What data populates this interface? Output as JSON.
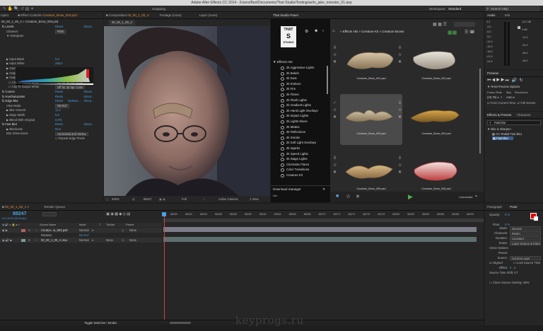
{
  "window_title": "Adobe After Effects CC 2014 - /Users/Bart/Documents/That Studio/Testing/ae/ts_jake_monster_01.aep",
  "toolbar": {
    "snapping": "Snapping",
    "workspace_label": "Workspace:",
    "workspace_value": "Standard",
    "search_placeholder": "Search Help"
  },
  "tabs": {
    "project": "roject",
    "effect_controls": "Effect Controls",
    "effect_controls_file": "Creature_Brow_003.psd",
    "composition": "Composition",
    "composition_name": "00_00_1_00_A",
    "footage": "Footage (none)",
    "layer": "Layer (none)",
    "tsp": "That Studio Panel",
    "audio": "Audio",
    "info": "Info",
    "preview": "Preview",
    "effects_presets": "Effects & Presets",
    "character": "Character",
    "paragraph": "Paragraph",
    "paint": "Paint"
  },
  "effect_controls": {
    "header": "00_00_1_00_A » Creature_Brow_003.psd",
    "rows": [
      {
        "label": "fx  Levels",
        "v1": "Reset",
        "v2": "About...",
        "indent": 0
      },
      {
        "label": "Channel:",
        "select": "RGB",
        "indent": 2
      },
      {
        "label": "▼ Histogram",
        "indent": 2
      },
      {
        "label": "▶ Input Black",
        "v1": "0,0",
        "indent": 2
      },
      {
        "label": "▶ Input White",
        "v1": "255,0",
        "indent": 2
      },
      {
        "label": "▶ Gamma",
        "v1": "1,00",
        "indent": 2
      },
      {
        "label": "▶ Output Black",
        "v1": "0,0",
        "indent": 2
      },
      {
        "label": "▶ Output White",
        "v1": "128,0",
        "indent": 2
      },
      {
        "label": "☐ Clip To Output Black",
        "select": "Off for 32 bpc Color",
        "indent": 3
      },
      {
        "label": "☐ Clip To Output White",
        "select": "Off for 32 bpc Color",
        "indent": 3
      },
      {
        "label": "fx  Curves",
        "v1": "Reset",
        "v2": "About...",
        "indent": 0
      },
      {
        "label": "fx  Hue/Saturation",
        "v1": "Reset",
        "v2": "About...",
        "indent": 0
      },
      {
        "label": "fx  Edge Blur",
        "v1": "Reset",
        "v2": "Options...",
        "v3": "About...",
        "indent": 0
      },
      {
        "label": "View Mode",
        "select": "Normal",
        "indent": 2
      },
      {
        "label": "▶ Blur Amount",
        "v1": "11,1",
        "indent": 2
      },
      {
        "label": "▶ Edge Width",
        "v1": "8,6",
        "indent": 2
      },
      {
        "label": "▶ Blend With Original",
        "v1": "0,0%",
        "indent": 2
      },
      {
        "label": "fx  Fast Blur",
        "v1": "Reset",
        "v2": "About...",
        "indent": 0
      },
      {
        "label": "▶ Blurriness",
        "v1": "50,0",
        "indent": 2
      },
      {
        "label": "Blur Dimensions",
        "select": "Horizontal and Vertic▾",
        "indent": 2
      },
      {
        "label": "",
        "check": "☐ Repeat Edge Pixels",
        "indent": 2
      }
    ]
  },
  "composition": {
    "zoom": "200%",
    "timecode": "88247",
    "resolution": "Full",
    "camera": "Active Camera",
    "views": "1 View"
  },
  "tsp": {
    "logo_lines": [
      "THAT",
      "S",
      "STUDIO"
    ],
    "category": "Effects HD",
    "breadcrumb": "» Effects HD » Creature Kit » Creature Brows",
    "items": [
      "2k Aggressive Lights",
      "2k Bokeh",
      "2k Dust",
      "2k Embers",
      "2k Fire",
      "2k Flares",
      "2k Flash Lights",
      "2k Gradient Lights",
      "2k Hand Light Overlays",
      "2k Impact Lights",
      "2k Lights Mixes",
      "2k Mattes",
      "2k Reflections",
      "2k Smoke",
      "2k Soft Light Overlays",
      "2k Sparks",
      "2k Speed Lights",
      "2k Stage Lights",
      "Cinematic Flares",
      "Color Transitions",
      "Creature Kit"
    ],
    "download_label": "Download manager",
    "download_idle": "Idle",
    "thumbnails": [
      "Creature_Brow_001.psd",
      "Creature_Brow_002.psd",
      "Creature_Brow_003.psd",
      "Creature_Brow_004.psd",
      "Creature_Brow_005.psd",
      "Creature_Brow_006.psd"
    ],
    "connected": "Connected"
  },
  "audio_scale": [
    "0,0",
    "-3,0",
    "-6,0",
    "-9,0",
    "-12,0",
    "-15,0",
    "-18,0",
    "-21,0",
    "-24,0"
  ],
  "audio_scale_right": [
    "12,0 dB",
    "0 dB",
    "-12,0",
    "-24,0",
    "-36,0",
    "-48,0"
  ],
  "preview": {
    "ram_options": "RAM Preview Options",
    "frame_rate_label": "Frame Rate",
    "skip_label": "Skip",
    "resolution_label": "Resolution",
    "frame_rate": "(25,76)",
    "skip": "0",
    "resolution": "Auto",
    "from_current": "From Current Time",
    "full_screen": "Full Screen"
  },
  "effects_presets": {
    "search": "Fast blur",
    "category": "▼ Blur & Sharpen",
    "items": [
      "CC Radial Fast Blur",
      "Fast Blur"
    ]
  },
  "timeline": {
    "comp_tab": "00_00_1_00_A",
    "render_queue": "Render Queue",
    "timecode": "88247",
    "subtimecode": "1:01:16:00 (25.00 fps)",
    "columns": {
      "source": "Source Name",
      "mode": "Mode",
      "t": "T",
      "trkmat": "TrkMat",
      "parent": "Parent"
    },
    "layers": [
      {
        "num": "1",
        "name": "Creatur...w_003.psd",
        "mode": "Normal",
        "trkmat": "",
        "parent": "None"
      },
      {
        "num": "2",
        "name": "00_00_1_00_A.mov",
        "mode": "Normal",
        "trkmat": "None",
        "parent": "None"
      }
    ],
    "rotation_label": "Rotation",
    "rotation_value": "0x+0,0°",
    "ruler": [
      "88250",
      "88252",
      "88254",
      "88256",
      "88258",
      "88260",
      "88262",
      "88264",
      "88266",
      "88268",
      "88270",
      "88272",
      "88274",
      "88276",
      "88278",
      "88280",
      "88282",
      "88284",
      "88286",
      "88288",
      "88290"
    ],
    "toggle": "Toggle Switches / Modes"
  },
  "paint": {
    "opacity_label": "Opacity:",
    "opacity": "0 %",
    "flow_label": "Flow:",
    "flow": "0 %",
    "mode_label": "Mode:",
    "mode": "Normal",
    "channels_label": "Channels:",
    "channels": "RGBA",
    "duration_label": "Duration:",
    "duration": "Constant",
    "erase_label": "Erase:",
    "erase": "Layer Source & Paint",
    "clone_options": "Clone Options",
    "preset_label": "Preset:",
    "source_label": "Source:",
    "source": "Current Layer",
    "aligned": "Aligned",
    "lock_source": "Lock Source Time",
    "offset_label": "Offset:",
    "offset": "0 , 0",
    "source_time_shift": "Source Time Shift: 0 f",
    "clone_overlay": "Clone Source Overlay: 50%"
  },
  "watermark": "keyprogs.ru"
}
